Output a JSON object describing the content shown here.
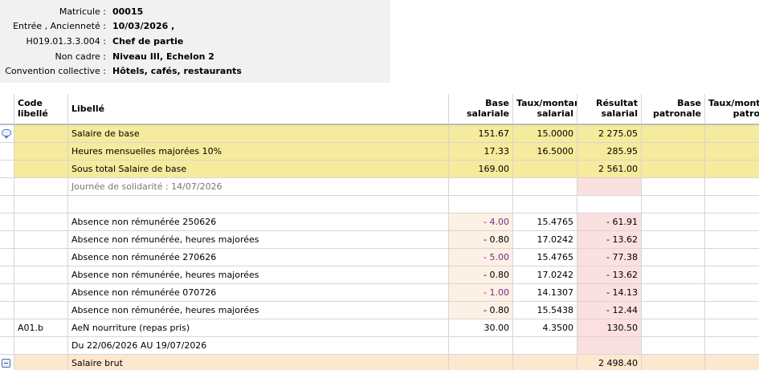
{
  "employee": {
    "matricule_label": "Matricule :",
    "matricule_value": "00015",
    "entree_label": "Entrée , Ancienneté :",
    "entree_value": "10/03/2026 ,",
    "poste_label": "H019.01.3.3.004 :",
    "poste_value": "Chef de partie",
    "statut_label": "Non cadre :",
    "statut_value": "Niveau III, Echelon 2",
    "convention_label": "Convention collective :",
    "convention_value": "Hôtels, cafés, restaurants"
  },
  "table": {
    "headers": {
      "code": "Code",
      "code2": "libellé",
      "libelle": "Libellé",
      "base_sal1": "Base",
      "base_sal2": "salariale",
      "taux_sal1": "Taux/montant",
      "taux_sal2": "salarial",
      "res_sal1": "Résultat",
      "res_sal2": "salarial",
      "base_pat1": "Base",
      "base_pat2": "patronale",
      "taux_pat1": "Taux/montar",
      "taux_pat2": "patron"
    },
    "rows": [
      {
        "code": "",
        "libelle": "Salaire de base",
        "base": "151.67",
        "taux": "15.0000",
        "resultat": "2 275.05"
      },
      {
        "code": "",
        "libelle": "Heures mensuelles majorées 10%",
        "base": "17.33",
        "taux": "16.5000",
        "resultat": "285.95"
      },
      {
        "code": "",
        "libelle": "Sous total Salaire de base",
        "base": "169.00",
        "taux": "",
        "resultat": "2 561.00"
      },
      {
        "code": "",
        "libelle": "Journée de solidarité : 14/07/2026",
        "base": "",
        "taux": "",
        "resultat": ""
      },
      {
        "code": "",
        "libelle": "",
        "base": "",
        "taux": "",
        "resultat": ""
      },
      {
        "code": "",
        "libelle": "Absence non rémunérée 250626",
        "base": "- 4.00",
        "taux": "15.4765",
        "resultat": "- 61.91"
      },
      {
        "code": "",
        "libelle": "Absence non rémunérée, heures majorées",
        "base": "- 0.80",
        "taux": "17.0242",
        "resultat": "- 13.62"
      },
      {
        "code": "",
        "libelle": "Absence non rémunérée 270626",
        "base": "- 5.00",
        "taux": "15.4765",
        "resultat": "- 77.38"
      },
      {
        "code": "",
        "libelle": "Absence non rémunérée, heures majorées",
        "base": "- 0.80",
        "taux": "17.0242",
        "resultat": "- 13.62"
      },
      {
        "code": "",
        "libelle": "Absence non rémunérée 070726",
        "base": "- 1.00",
        "taux": "14.1307",
        "resultat": "- 14.13"
      },
      {
        "code": "",
        "libelle": "Absence non rémunérée, heures majorées",
        "base": "- 0.80",
        "taux": "15.5438",
        "resultat": "- 12.44"
      },
      {
        "code": "A01.b",
        "libelle": "AeN nourriture (repas pris)",
        "base": "30.00",
        "taux": "4.3500",
        "resultat": "130.50"
      },
      {
        "code": "",
        "libelle": "Du 22/06/2026 AU 19/07/2026",
        "base": "",
        "taux": "",
        "resultat": ""
      },
      {
        "code": "",
        "libelle": "Salaire brut",
        "base": "",
        "taux": "",
        "resultat": "2 498.40"
      }
    ]
  },
  "colors": {
    "yellow_band": "#f6ea9c",
    "pink_cell": "#fbe0e0",
    "peach_cell": "#fdf0e4",
    "total_row": "#fde7cf",
    "purple_value": "#7b2a8c"
  },
  "icons": {
    "row0": "comment-icon",
    "row13": "collapse-icon"
  }
}
